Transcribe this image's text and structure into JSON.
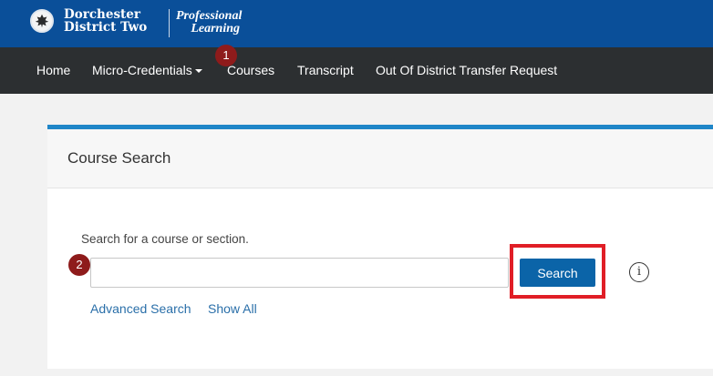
{
  "brand": {
    "org_line1": "Dorchester",
    "org_line2": "District Two",
    "sub_line1": "Professional",
    "sub_line2": "Learning",
    "logo_icon": "district-seal-icon"
  },
  "nav": {
    "items": [
      {
        "label": "Home"
      },
      {
        "label": "Micro-Credentials",
        "has_dropdown": true
      },
      {
        "label": "Courses"
      },
      {
        "label": "Transcript"
      },
      {
        "label": "Out Of District Transfer Request"
      }
    ]
  },
  "steps": {
    "step1": "1",
    "step2": "2"
  },
  "card": {
    "title": "Course Search",
    "prompt": "Search for a course or section.",
    "search_value": "",
    "search_button": "Search",
    "info_glyph": "i",
    "advanced_link": "Advanced Search",
    "show_all_link": "Show All"
  },
  "colors": {
    "brand_bar": "#0a4f99",
    "nav_bar": "#2c2f31",
    "accent": "#1f86c8",
    "button": "#0b64a8",
    "highlight": "#e01e26",
    "badge": "#8e1b1b"
  }
}
